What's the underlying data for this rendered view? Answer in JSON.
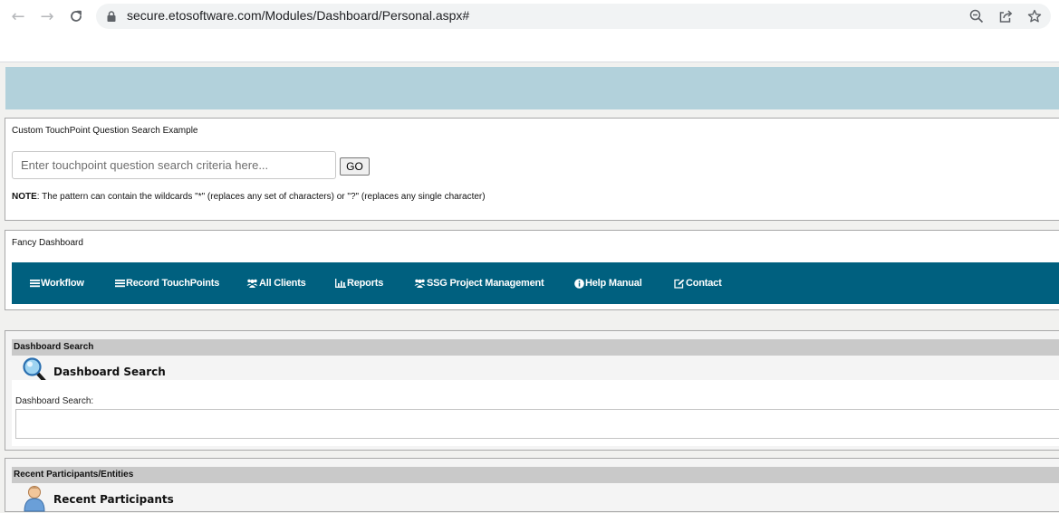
{
  "browser": {
    "url": "secure.etosoftware.com/Modules/Dashboard/Personal.aspx#"
  },
  "touchpoint_search": {
    "title": "Custom TouchPoint Question Search Example",
    "placeholder": "Enter touchpoint question search criteria here...",
    "go_label": "GO",
    "note_label": "NOTE",
    "note_text": ": The pattern can contain the wildcards \"*\" (replaces any set of characters) or \"?\" (replaces any single character)"
  },
  "fancy_dashboard": {
    "title": "Fancy Dashboard",
    "nav_color": "#00607f",
    "items": [
      {
        "label": "Workflow",
        "icon": "bars-icon"
      },
      {
        "label": "Record TouchPoints",
        "icon": "bars-icon"
      },
      {
        "label": "All Clients",
        "icon": "users-icon"
      },
      {
        "label": "Reports",
        "icon": "bar-chart-icon"
      },
      {
        "label": "SSG Project Management",
        "icon": "users-icon"
      },
      {
        "label": "Help Manual",
        "icon": "info-circle-icon"
      },
      {
        "label": "Contact",
        "icon": "edit-icon"
      }
    ]
  },
  "dashboard_search": {
    "header": "Dashboard Search",
    "title": "Dashboard Search",
    "label": "Dashboard Search:",
    "icon": "magnifier-icon",
    "value": ""
  },
  "recent_participants": {
    "header": "Recent Participants/Entities",
    "title": "Recent Participants",
    "icon": "person-icon"
  },
  "colors": {
    "banner": "#b2d1db",
    "section_header": "#c9c9c9"
  }
}
